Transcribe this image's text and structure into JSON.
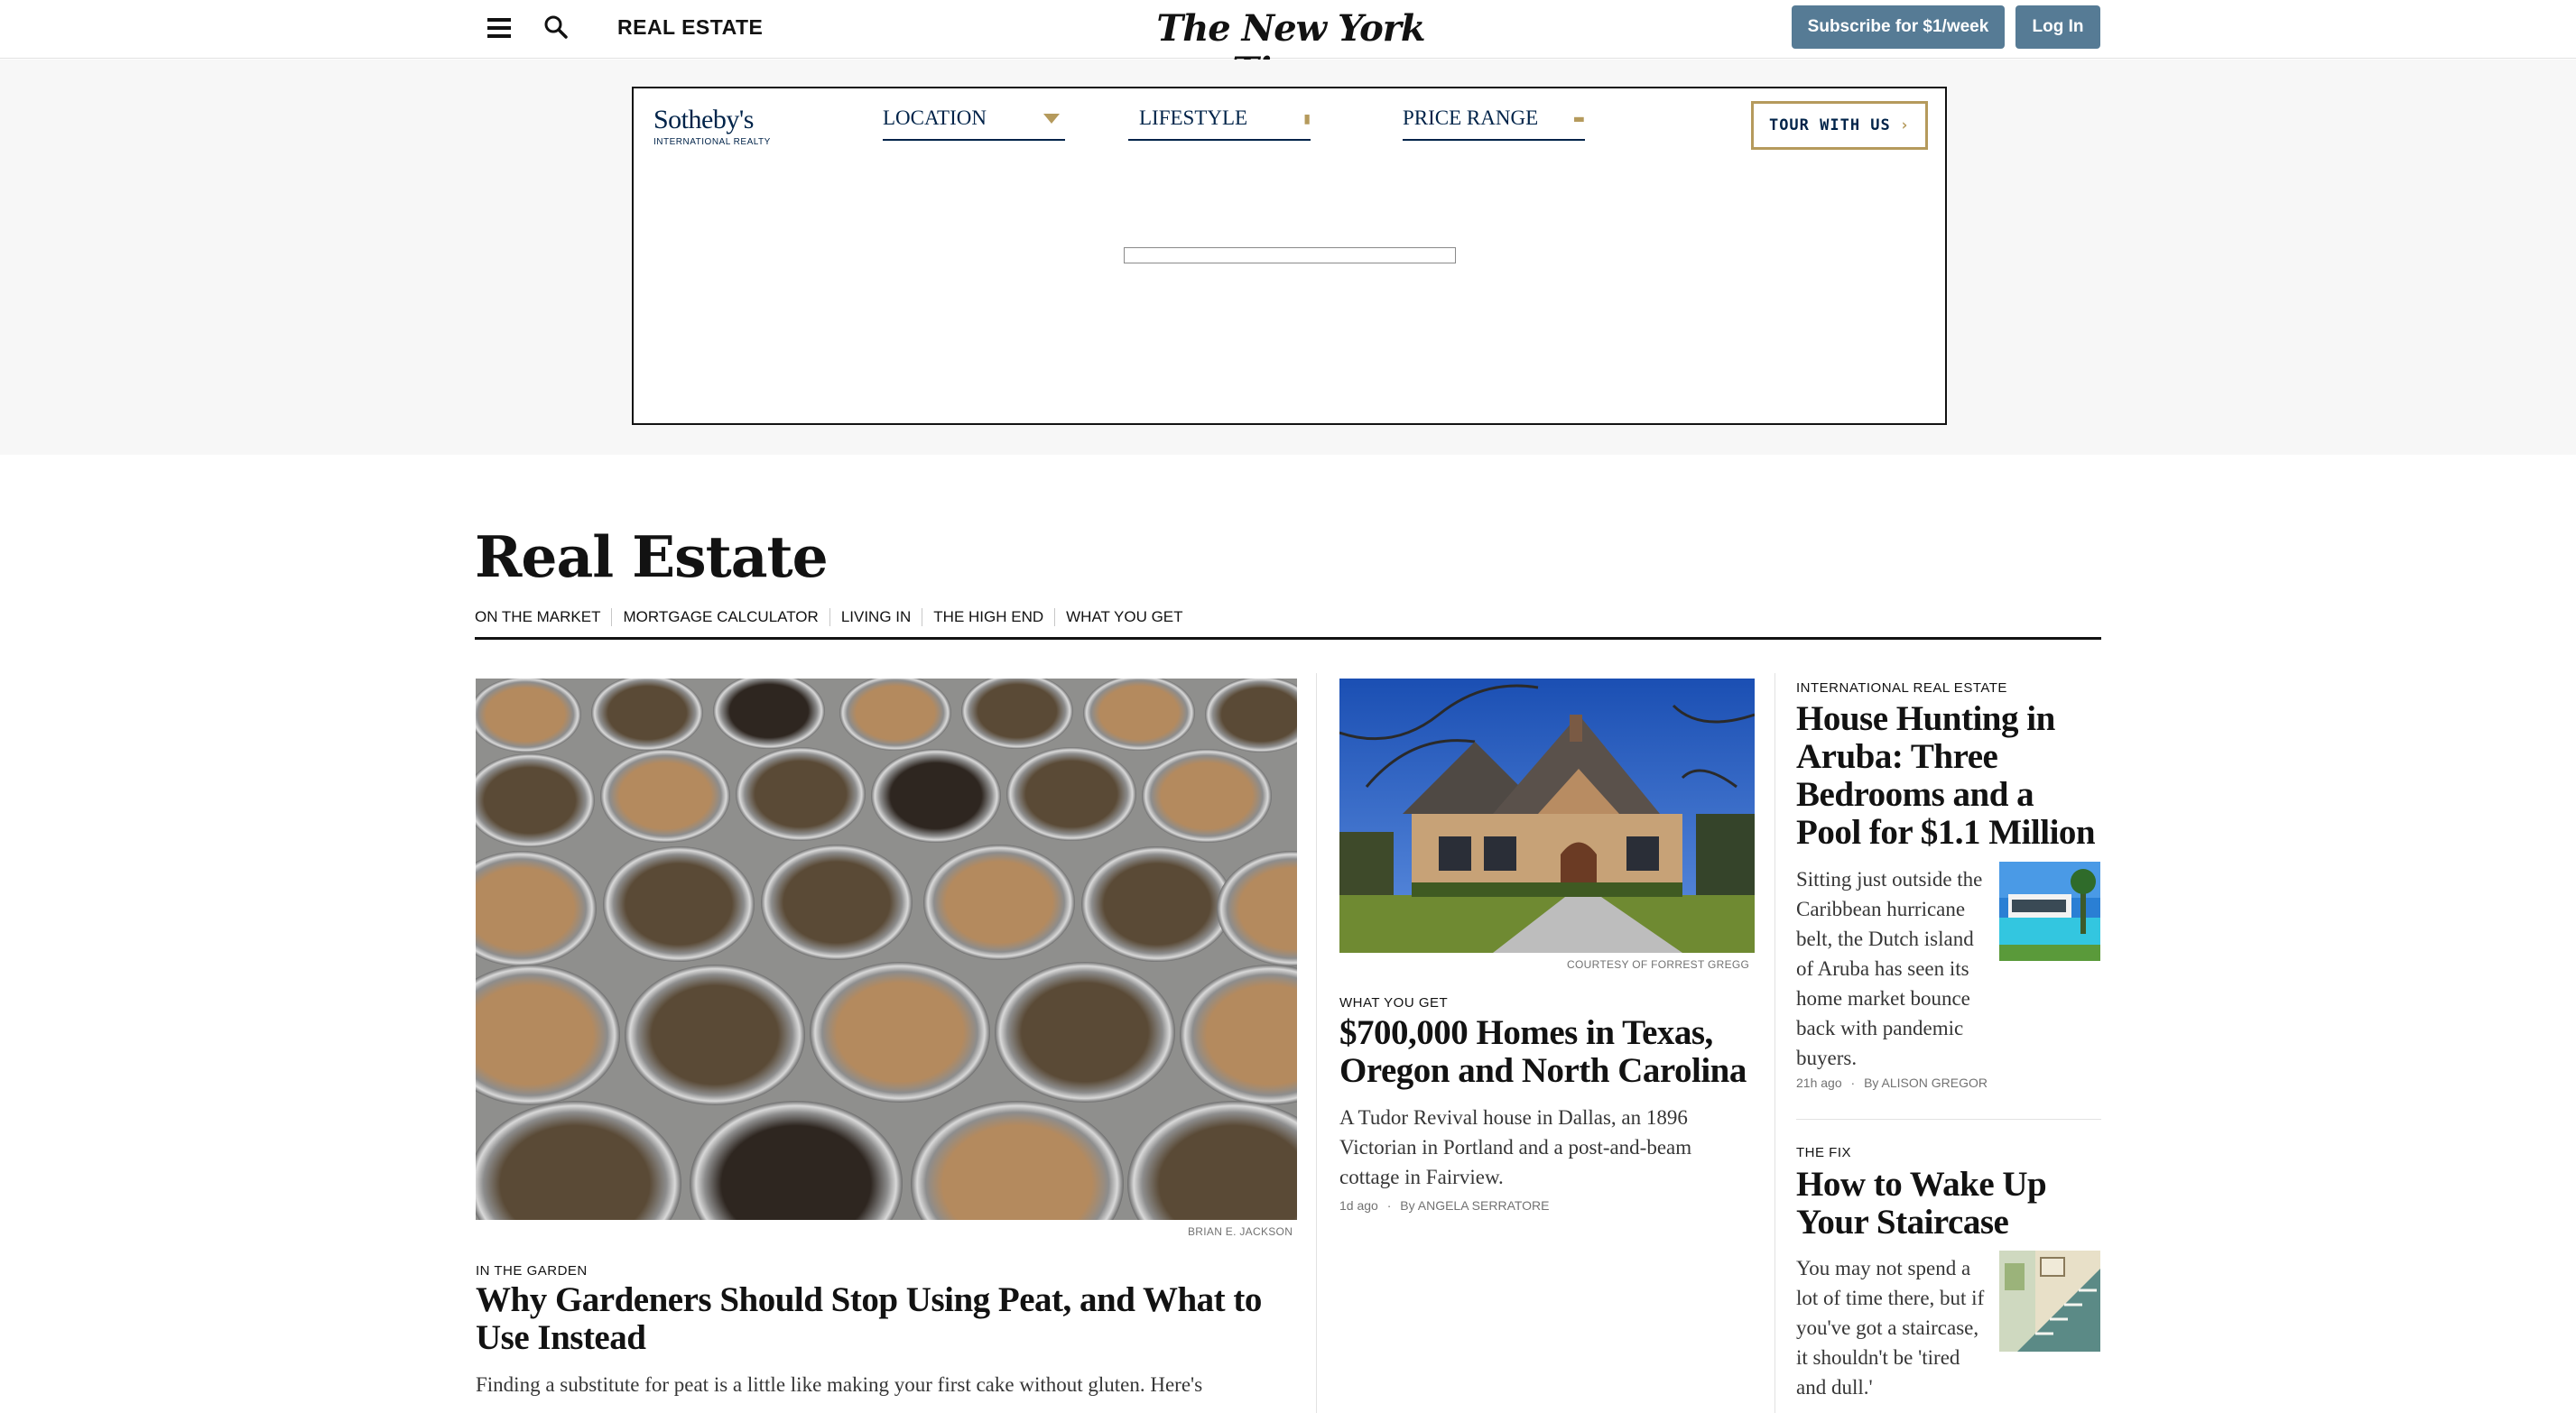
{
  "topbar": {
    "menu_icon": "hamburger-menu-icon",
    "search_icon": "search-icon",
    "section_label": "REAL ESTATE",
    "masthead": "The New York Times",
    "subscribe_label": "Subscribe for $1/week",
    "login_label": "Log In",
    "button_color": "#567b95"
  },
  "ad": {
    "brand_name": "Sotheby's",
    "brand_sub": "INTERNATIONAL REALTY",
    "filters": [
      {
        "label": "LOCATION",
        "icon": "caret-down-icon"
      },
      {
        "label": "LIFESTYLE",
        "icon": "lifestyle-icon"
      },
      {
        "label": "PRICE RANGE",
        "icon": "price-icon"
      }
    ],
    "tour_label": "TOUR WITH US",
    "tour_icon": "arrow-icon",
    "brand_color": "#002349",
    "accent_color": "#b59a5c"
  },
  "section": {
    "title": "Real Estate",
    "subnav": [
      "ON THE MARKET",
      "MORTGAGE CALCULATOR",
      "LIVING IN",
      "THE HIGH END",
      "WHAT YOU GET"
    ]
  },
  "lead": {
    "image": "bowls-of-mulch-photo",
    "credit": "BRIAN E. JACKSON",
    "kicker": "IN THE GARDEN",
    "headline": "Why Gardeners Should Stop Using Peat, and What to Use Instead",
    "summary": "Finding a substitute for peat is a little like making your first cake without gluten. Here's"
  },
  "middle": {
    "image": "tudor-revival-house-photo",
    "credit": "COURTESY OF FORREST GREGG",
    "kicker": "WHAT YOU GET",
    "headline": "$700,000 Homes in Texas, Oregon and North Carolina",
    "summary": "A Tudor Revival house in Dallas, an 1896 Victorian in Portland and a post-and-beam cottage in Fairview.",
    "time": "1d ago",
    "byline_prefix": "By",
    "author": "ANGELA SERRATORE"
  },
  "right": [
    {
      "image": "aruba-pool-house-thumbnail",
      "kicker": "INTERNATIONAL REAL ESTATE",
      "headline": "House Hunting in Aruba: Three Bedrooms and a Pool for $1.1 Million",
      "summary": "Sitting just outside the Caribbean hurricane belt, the Dutch island of Aruba has seen its home market bounce back with pandemic buyers.",
      "time": "21h ago",
      "byline_prefix": "By",
      "author": "ALISON GREGOR"
    },
    {
      "image": "staircase-thumbnail",
      "kicker": "THE FIX",
      "headline": "How to Wake Up Your Staircase",
      "summary": "You may not spend a lot of time there, but if you've got a staircase, it shouldn't be 'tired and dull.'"
    }
  ]
}
